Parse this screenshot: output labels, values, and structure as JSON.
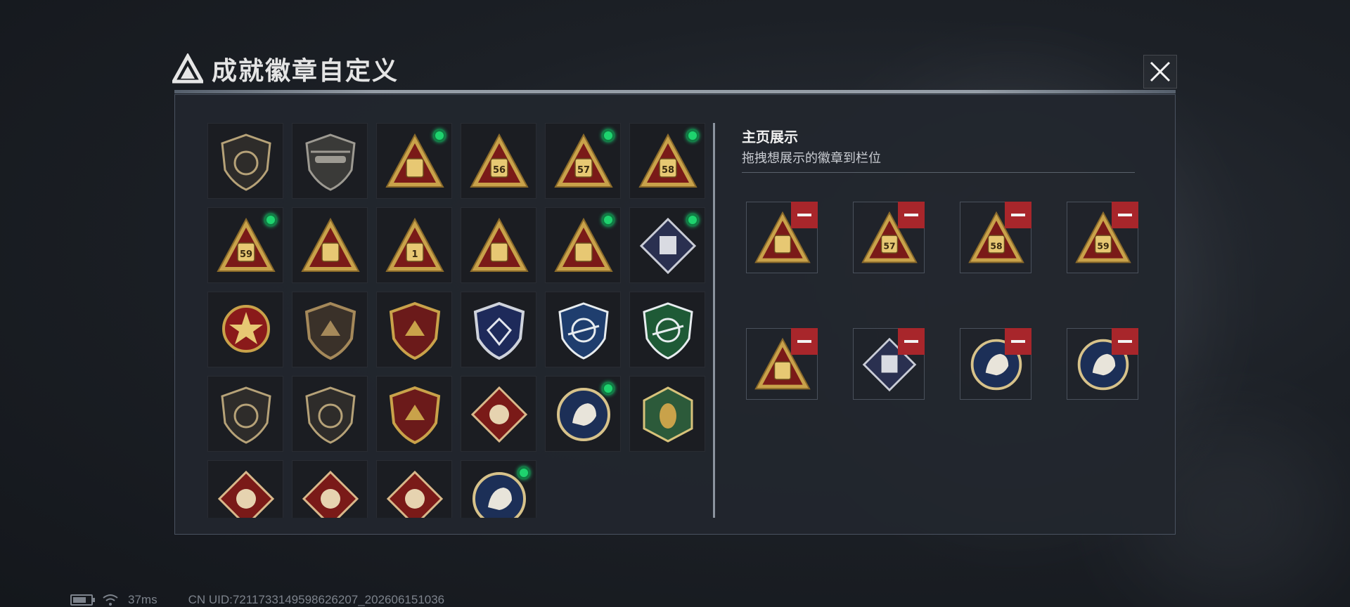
{
  "header": {
    "title": "成就徽章自定义"
  },
  "display": {
    "title": "主页展示",
    "subtitle": "拖拽想展示的徽章到栏位"
  },
  "status": {
    "ping": "37ms",
    "uid": "CN UID:7211733149598626207_202606151036"
  },
  "colors": {
    "accent_green": "#1ed36e",
    "remove_red": "#a8262b"
  },
  "badges": [
    {
      "shape": "shield-dark",
      "label": "",
      "dot": false
    },
    {
      "shape": "shield-heli",
      "label": "",
      "dot": false
    },
    {
      "shape": "tri",
      "label": "",
      "dot": true
    },
    {
      "shape": "tri",
      "label": "56",
      "dot": false
    },
    {
      "shape": "tri",
      "label": "57",
      "dot": true
    },
    {
      "shape": "tri",
      "label": "58",
      "dot": true
    },
    {
      "shape": "tri",
      "label": "59",
      "dot": true
    },
    {
      "shape": "tri",
      "label": "",
      "dot": false
    },
    {
      "shape": "tri",
      "label": "1",
      "dot": false
    },
    {
      "shape": "tri",
      "label": "",
      "dot": false
    },
    {
      "shape": "tri",
      "label": "",
      "dot": true
    },
    {
      "shape": "diamond-silver",
      "label": "",
      "dot": true
    },
    {
      "shape": "round-star",
      "label": "",
      "dot": false
    },
    {
      "shape": "shield-bronze",
      "label": "",
      "dot": false
    },
    {
      "shape": "shield-gold",
      "label": "",
      "dot": false
    },
    {
      "shape": "shield-silver",
      "label": "",
      "dot": false
    },
    {
      "shape": "shield-blue",
      "label": "",
      "dot": false
    },
    {
      "shape": "shield-green",
      "label": "",
      "dot": false
    },
    {
      "shape": "shield-dark",
      "label": "",
      "dot": false
    },
    {
      "shape": "shield-dark",
      "label": "",
      "dot": false
    },
    {
      "shape": "shield-gold",
      "label": "",
      "dot": false
    },
    {
      "shape": "diamond-red",
      "label": "",
      "dot": false
    },
    {
      "shape": "circle-blue",
      "label": "",
      "dot": true
    },
    {
      "shape": "hex-green",
      "label": "",
      "dot": false
    },
    {
      "shape": "diamond-red",
      "label": "",
      "dot": false
    },
    {
      "shape": "diamond-red",
      "label": "",
      "dot": false
    },
    {
      "shape": "diamond-red",
      "label": "",
      "dot": false
    },
    {
      "shape": "circle-blue",
      "label": "",
      "dot": true
    }
  ],
  "display_slots": [
    {
      "shape": "tri",
      "label": ""
    },
    {
      "shape": "tri",
      "label": "57"
    },
    {
      "shape": "tri",
      "label": "58"
    },
    {
      "shape": "tri",
      "label": "59"
    },
    {
      "shape": "tri",
      "label": ""
    },
    {
      "shape": "diamond-silver",
      "label": ""
    },
    {
      "shape": "circle-blue",
      "label": ""
    },
    {
      "shape": "circle-blue",
      "label": ""
    }
  ]
}
